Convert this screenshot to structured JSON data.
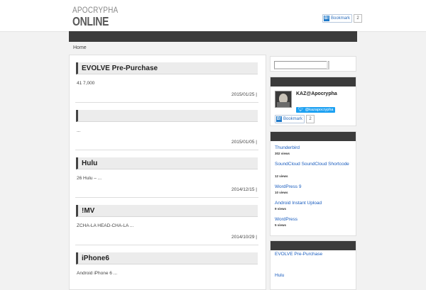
{
  "header": {
    "logo_top": "APOCRYPHA",
    "logo_bottom": "ONLINE",
    "bookmark_icon": "B!",
    "bookmark_label": "Bookmark",
    "bookmark_count": "2"
  },
  "breadcrumb": {
    "home": "Home"
  },
  "posts": [
    {
      "title": "EVOLVE Pre-Purchase",
      "excerpt": "41 7,000",
      "date": "2015/01/25 |"
    },
    {
      "title": "",
      "excerpt": "...",
      "date": "2015/01/05 |"
    },
    {
      "title": "Hulu",
      "excerpt": "26 Hulu  –  ...",
      "date": "2014/12/15 |"
    },
    {
      "title": "!MV",
      "excerpt": "ZCHA-LA HEAD-CHA-LA ...",
      "date": "2014/10/29 |"
    },
    {
      "title": "iPhone6",
      "excerpt": "Android iPhone 6  ...",
      "date": ""
    }
  ],
  "sidebar": {
    "profile": {
      "author": "KAZ@Apocrypha",
      "twitter_handle": "@kazapocrypha",
      "bookmark_icon": "B!",
      "bookmark_label": "Bookmark",
      "bookmark_count": "2"
    },
    "popular": [
      {
        "title": "Thunderbird",
        "views": "302 views"
      },
      {
        "title": "SoundCloud  SoundCloud Shortcode",
        "views": "12 views"
      },
      {
        "title": "WordPress 9",
        "views": "10 views"
      },
      {
        "title": "Android  Instant Upload",
        "views": "9 views"
      },
      {
        "title": "WordPress",
        "views": "5 views"
      }
    ],
    "recent": [
      {
        "title": "EVOLVE Pre-Purchase"
      },
      {
        "title": "Hulu"
      }
    ]
  },
  "colors": {
    "nav_bar": "#3b3b3b",
    "link": "#1a5dbf",
    "twitter": "#1da1f2",
    "hatena": "#1e79c9"
  },
  "icons": {
    "twitter": "twitter-bird-icon",
    "bookmark": "hatena-bookmark-icon",
    "avatar": "author-avatar"
  }
}
